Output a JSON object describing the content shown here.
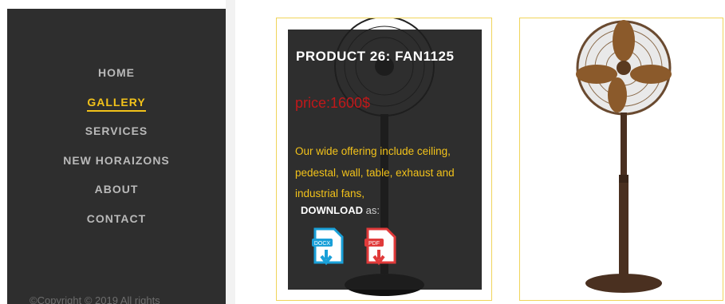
{
  "nav": {
    "items": [
      {
        "label": "HOME"
      },
      {
        "label": "GALLERY"
      },
      {
        "label": "SERVICES"
      },
      {
        "label": "NEW HORAIZONS"
      },
      {
        "label": "ABOUT"
      },
      {
        "label": "CONTACT"
      }
    ],
    "active": "GALLERY"
  },
  "footer": {
    "copyright": "©Copyright © 2019 All rights"
  },
  "product": {
    "title": "PRODUCT 26: FAN1125",
    "price": "price:1600$",
    "description": "Our wide offering include ceiling, pedestal, wall, table, exhaust and industrial fans,",
    "download_strong": "DOWNLOAD",
    "download_rest": " as:",
    "files": [
      {
        "label": "DOCX",
        "icon": "docx-file-icon",
        "color": "#1aa0d8"
      },
      {
        "label": "PDF",
        "icon": "pdf-file-icon",
        "color": "#e03a3a"
      }
    ]
  },
  "colors": {
    "accent": "#f2c21a",
    "price": "#c0181a",
    "sidebar": "#2e2e2e",
    "card_border": "#f0d45a"
  }
}
